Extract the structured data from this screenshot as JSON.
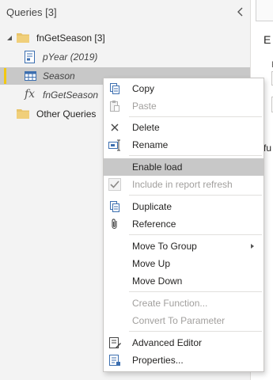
{
  "queries_pane": {
    "title": "Queries [3]",
    "groups": [
      {
        "label": "fnGetSeason [3]",
        "expanded": true,
        "items": [
          {
            "label": "pYear (2019)",
            "icon": "parameter-icon",
            "italic": true,
            "selected": false
          },
          {
            "label": "Season",
            "icon": "table-icon",
            "italic": true,
            "selected": true
          },
          {
            "label": "fnGetSeason",
            "icon": "function-icon",
            "italic": true,
            "selected": false
          }
        ]
      },
      {
        "label": "Other Queries",
        "expanded": false,
        "items": []
      }
    ]
  },
  "editor_fragments": {
    "top": "E",
    "mid": "F",
    "right": "fu"
  },
  "context_menu": {
    "items": [
      {
        "label": "Copy",
        "icon": "copy-icon",
        "enabled": true
      },
      {
        "label": "Paste",
        "icon": "paste-icon",
        "enabled": false
      },
      {
        "label": "Delete",
        "icon": "delete-x-icon",
        "enabled": true
      },
      {
        "label": "Rename",
        "icon": "rename-icon",
        "enabled": true
      },
      {
        "label": "Enable load",
        "icon": "",
        "enabled": true,
        "highlighted": true
      },
      {
        "label": "Include in report refresh",
        "icon": "checkmark-icon",
        "enabled": false
      },
      {
        "label": "Duplicate",
        "icon": "duplicate-icon",
        "enabled": true
      },
      {
        "label": "Reference",
        "icon": "reference-icon",
        "enabled": true
      },
      {
        "label": "Move To Group",
        "icon": "",
        "enabled": true,
        "submenu": true
      },
      {
        "label": "Move Up",
        "icon": "",
        "enabled": true
      },
      {
        "label": "Move Down",
        "icon": "",
        "enabled": true
      },
      {
        "label": "Create Function...",
        "icon": "",
        "enabled": false
      },
      {
        "label": "Convert To Parameter",
        "icon": "",
        "enabled": false
      },
      {
        "label": "Advanced Editor",
        "icon": "advanced-editor-icon",
        "enabled": true
      },
      {
        "label": "Properties...",
        "icon": "properties-icon",
        "enabled": true
      }
    ]
  },
  "colors": {
    "selection_bar": "#f2c811",
    "folder": "#e8c46a",
    "highlight": "#c8c8c8"
  }
}
